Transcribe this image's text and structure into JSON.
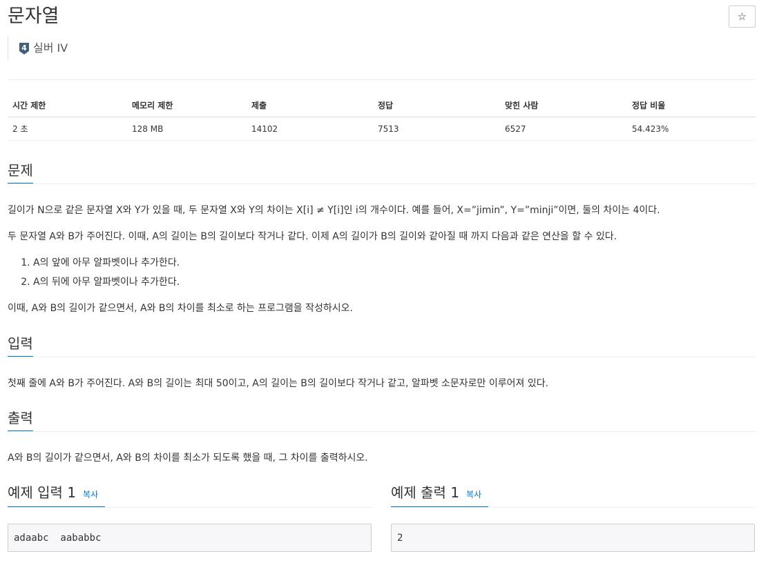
{
  "problem": {
    "title": "문자열",
    "star_label": "☆",
    "tier_number": "4",
    "tier_label": "실버 IV"
  },
  "stats": {
    "headers": [
      "시간 제한",
      "메모리 제한",
      "제출",
      "정답",
      "맞힌 사람",
      "정답 비율"
    ],
    "values": [
      "2 초",
      "128 MB",
      "14102",
      "7513",
      "6527",
      "54.423%"
    ]
  },
  "sections": {
    "description_title": "문제",
    "description_p1": "길이가 N으로 같은 문자열 X와 Y가 있을 때, 두 문자열 X와 Y의 차이는 X[i] ≠ Y[i]인 i의 개수이다. 예를 들어, X=”jimin”, Y=”minji”이면, 둘의 차이는 4이다.",
    "description_p2": "두 문자열 A와 B가 주어진다. 이때, A의 길이는 B의 길이보다 작거나 같다. 이제 A의 길이가 B의 길이와 같아질 때 까지 다음과 같은 연산을 할 수 있다.",
    "steps": [
      "A의 앞에 아무 알파벳이나 추가한다.",
      "A의 뒤에 아무 알파벳이나 추가한다."
    ],
    "description_p3": "이때, A와 B의 길이가 같으면서, A와 B의 차이를 최소로 하는 프로그램을 작성하시오.",
    "input_title": "입력",
    "input_text": "첫째 줄에 A와 B가 주어진다. A와 B의 길이는 최대 50이고, A의 길이는 B의 길이보다 작거나 같고, 알파벳 소문자로만 이루어져 있다.",
    "output_title": "출력",
    "output_text": "A와 B의 길이가 같으면서, A와 B의 차이를 최소가 되도록 했을 때, 그 차이를 출력하시오."
  },
  "samples": {
    "input_title": "예제 입력 1",
    "output_title": "예제 출력 1",
    "copy_label": "복사",
    "input_value": "adaabc  aababbc",
    "output_value": "2"
  },
  "colors": {
    "accent": "#0076c0",
    "tier_silver": "#435f7a"
  }
}
